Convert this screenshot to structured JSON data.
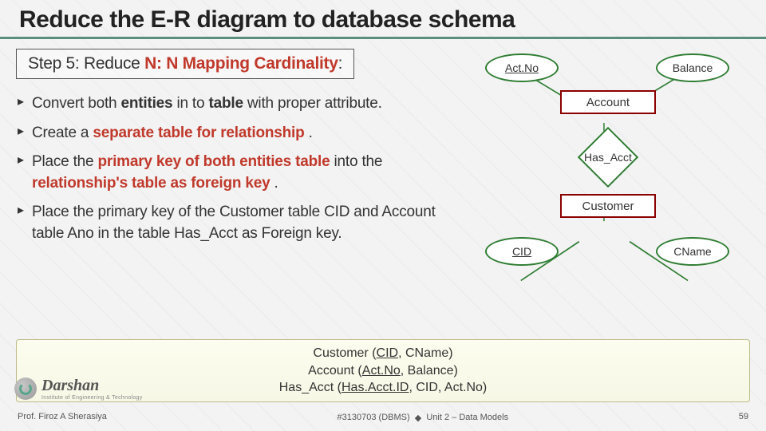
{
  "title": "Reduce the E-R diagram to database schema",
  "step": {
    "prefix": "Step 5: Reduce ",
    "highlight": "N: N Mapping Cardinality",
    "suffix": ":"
  },
  "bullets": [
    {
      "parts": [
        {
          "t": "Convert both "
        },
        {
          "t": "entities",
          "cls": "b-bold"
        },
        {
          "t": " in to "
        },
        {
          "t": "table",
          "cls": "b-bold"
        },
        {
          "t": " with proper attribute."
        }
      ]
    },
    {
      "parts": [
        {
          "t": "Create a "
        },
        {
          "t": "separate table for relationship",
          "cls": "b-red"
        },
        {
          "t": " ."
        }
      ]
    },
    {
      "parts": [
        {
          "t": "Place the "
        },
        {
          "t": "primary key of both entities table",
          "cls": "b-red"
        },
        {
          "t": " into the "
        },
        {
          "t": "relationship's table as foreign key",
          "cls": "b-red"
        },
        {
          "t": " ."
        }
      ]
    },
    {
      "parts": [
        {
          "t": "Place the primary key of the Customer table CID and Account table Ano in the table Has_Acct as Foreign key."
        }
      ]
    }
  ],
  "er": {
    "attrs": {
      "actno": {
        "label": "Act.No",
        "key": true
      },
      "balance": {
        "label": "Balance",
        "key": false
      },
      "cid": {
        "label": "CID",
        "key": true
      },
      "cname": {
        "label": "CName",
        "key": false
      }
    },
    "entities": {
      "account": "Account",
      "customer": "Customer"
    },
    "rel": "Has_Acct"
  },
  "schema": {
    "lines": [
      {
        "name": "Customer",
        "key": "CID",
        "rest": ", CName)"
      },
      {
        "name": "Account",
        "key": "Act.No",
        "rest": ", Balance)"
      },
      {
        "name": "Has_Acct",
        "key": "Has.Acct.ID",
        "rest": ", CID, Act.No)"
      }
    ]
  },
  "footer": {
    "author": "Prof. Firoz A Sherasiya",
    "code": "#3130703 (DBMS)",
    "unit": "Unit 2 – Data Models",
    "page": "59"
  },
  "logo": {
    "word": "Darshan",
    "sub": "Institute of Engineering & Technology"
  }
}
